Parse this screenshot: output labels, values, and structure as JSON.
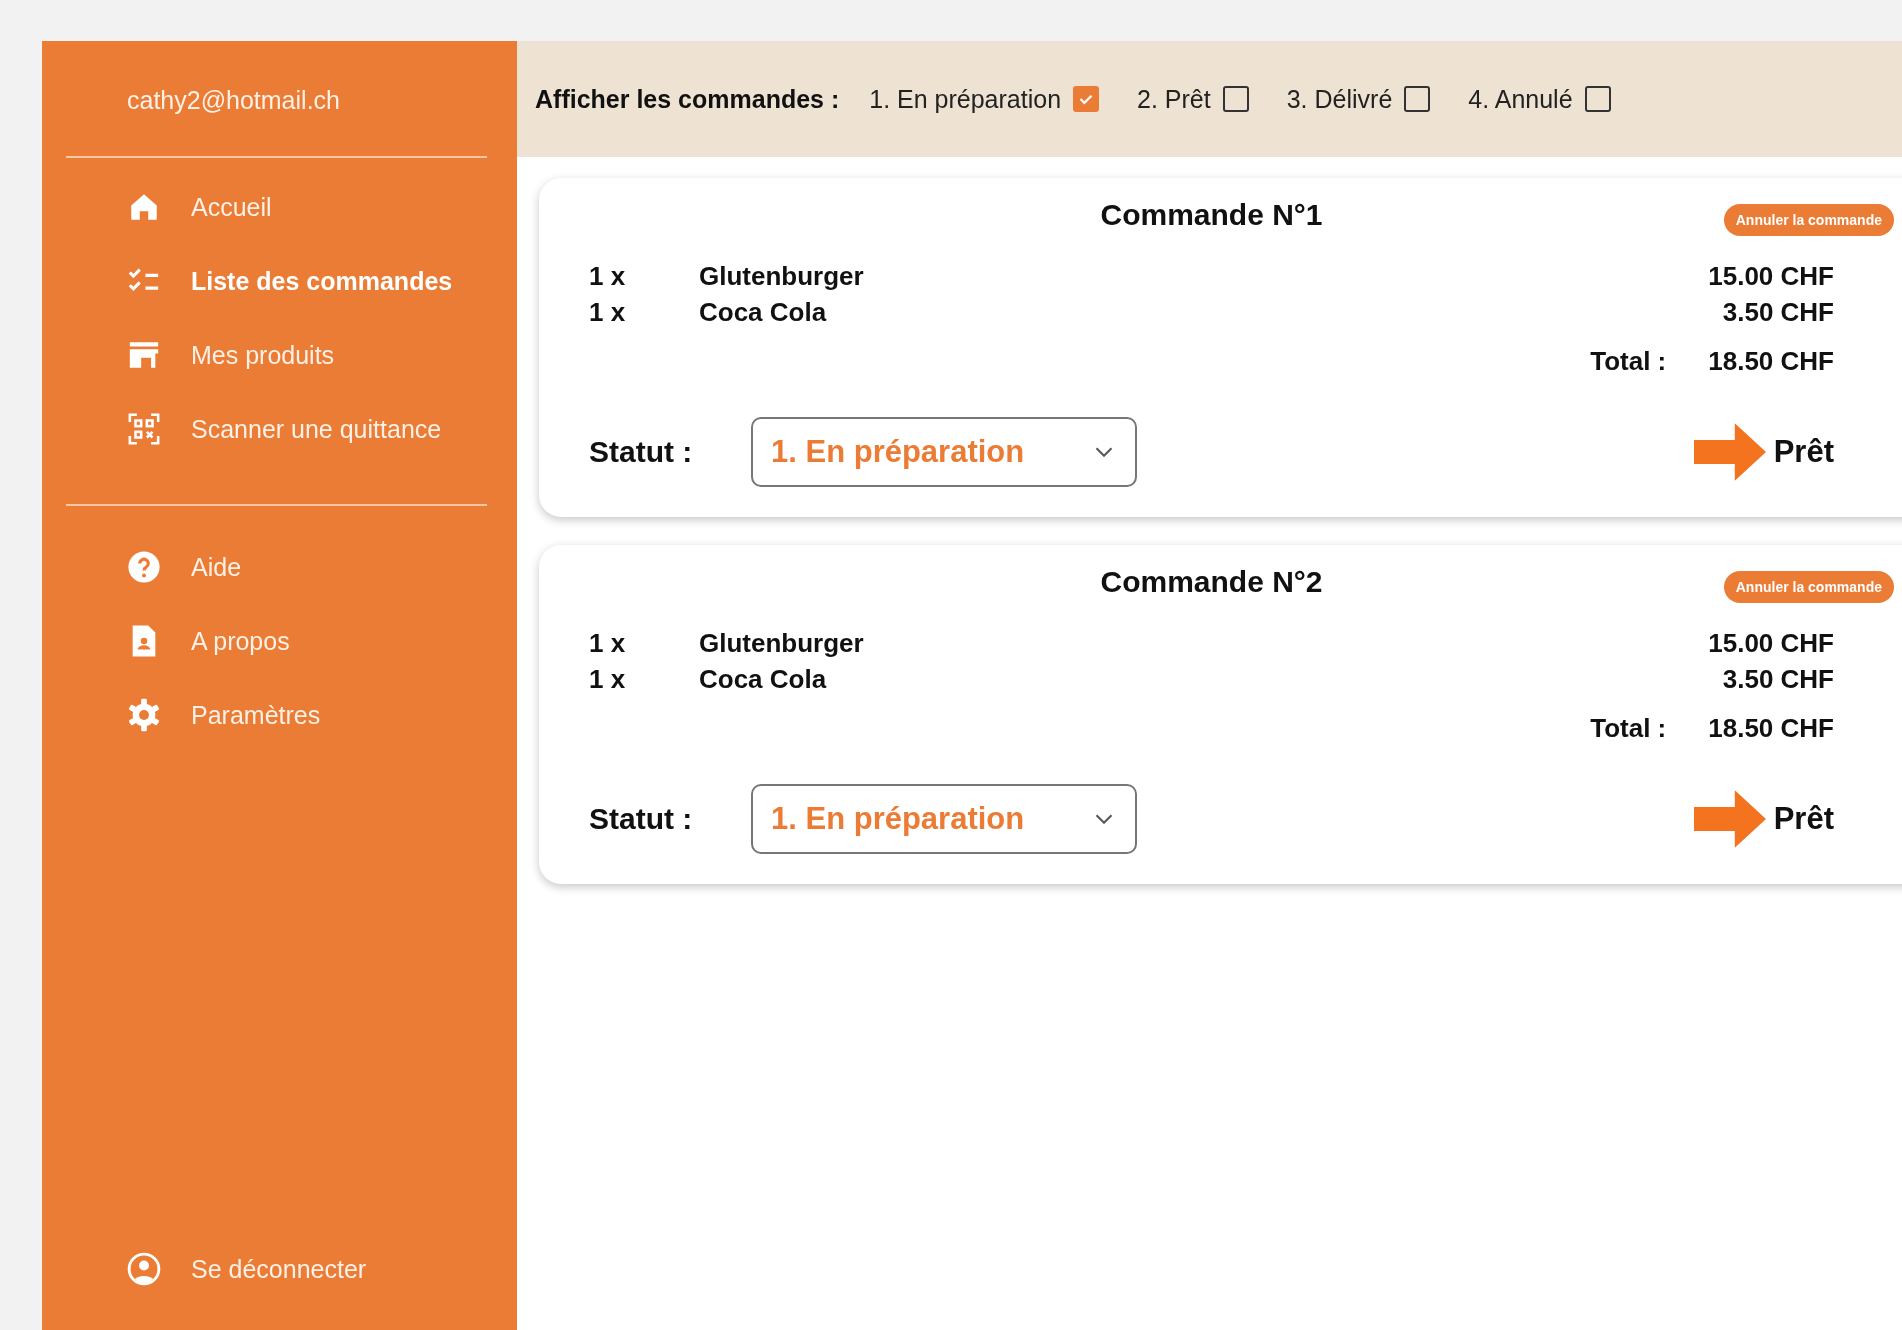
{
  "sidebar": {
    "user_email": "cathy2@hotmail.ch",
    "main_items": [
      {
        "kind": "home",
        "label": "Accueil",
        "selected": false
      },
      {
        "kind": "checklist",
        "label": "Liste des commandes",
        "selected": true
      },
      {
        "kind": "store",
        "label": "Mes produits",
        "selected": false
      },
      {
        "kind": "scan",
        "label": "Scanner une quittance",
        "selected": false
      }
    ],
    "secondary_items": [
      {
        "kind": "help",
        "label": "Aide",
        "selected": false
      },
      {
        "kind": "document",
        "label": "A propos",
        "selected": false
      },
      {
        "kind": "settings",
        "label": "Paramètres",
        "selected": false
      }
    ],
    "logout": {
      "kind": "account",
      "label": "Se déconnecter"
    }
  },
  "filter_bar": {
    "label": "Afficher les commandes :",
    "filters": [
      {
        "label": "1. En préparation",
        "checked": true
      },
      {
        "label": "2. Prêt",
        "checked": false
      },
      {
        "label": "3. Délivré",
        "checked": false
      },
      {
        "label": "4. Annulé",
        "checked": false
      }
    ]
  },
  "orders": [
    {
      "title": "Commande N°1",
      "cancel_button": "Annuler la commande",
      "items": [
        {
          "quantity": "1 x",
          "name": "Glutenburger",
          "price": "15.00 CHF"
        },
        {
          "quantity": "1 x",
          "name": "Coca Cola",
          "price": "3.50 CHF"
        }
      ],
      "total_label": "Total :",
      "total": "18.50 CHF",
      "status_label": "Statut :",
      "status_value": "1. En préparation",
      "next_action": "Prêt"
    },
    {
      "title": "Commande N°2",
      "cancel_button": "Annuler la commande",
      "items": [
        {
          "quantity": "1 x",
          "name": "Glutenburger",
          "price": "15.00 CHF"
        },
        {
          "quantity": "1 x",
          "name": "Coca Cola",
          "price": "3.50 CHF"
        }
      ],
      "total_label": "Total :",
      "total": "18.50 CHF",
      "status_label": "Statut :",
      "status_value": "1. En préparation",
      "next_action": "Prêt"
    }
  ]
}
